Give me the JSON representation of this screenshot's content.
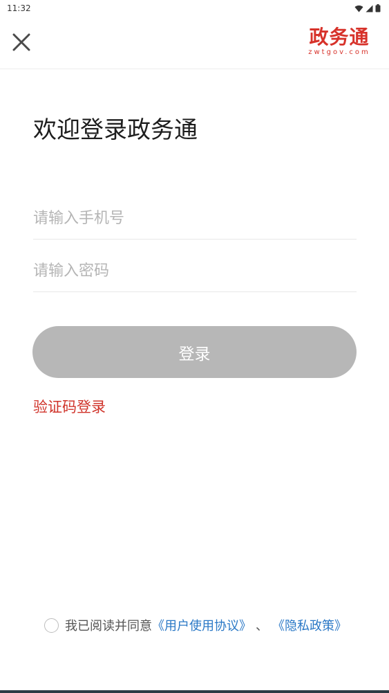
{
  "status_bar": {
    "time": "11:32"
  },
  "header": {
    "logo_text": "政务通",
    "logo_domain": "zwtgov.com"
  },
  "title": "欢迎登录政务通",
  "form": {
    "phone_placeholder": "请输入手机号",
    "password_placeholder": "请输入密码",
    "login_label": "登录",
    "sms_login_label": "验证码登录"
  },
  "agreement": {
    "prefix": "我已阅读并同意",
    "user_agreement": "《用户使用协议》",
    "separator": "、",
    "privacy_policy": "《隐私政策》"
  },
  "colors": {
    "brand": "#d7322a",
    "link": "#2a78c6",
    "button_disabled": "#b7b7b7"
  }
}
